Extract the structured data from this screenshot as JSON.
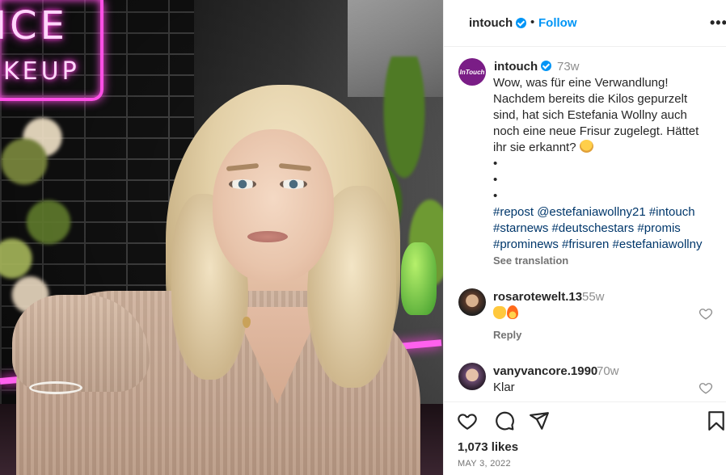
{
  "header": {
    "username": "intouch",
    "separator": "•",
    "follow_label": "Follow",
    "more_label": "•••"
  },
  "photo": {
    "neon_line1": "ICE",
    "neon_line2": "KEUP"
  },
  "post": {
    "avatar_text": "InTouch",
    "username": "intouch",
    "time": "73w",
    "caption_lines": [
      "Wow, was für eine Verwandlung!",
      "Nachdem bereits die Kilos gepurzelt",
      "sind, hat sich Estefania Wollny auch",
      "noch eine neue Frisur zugelegt. Hättet",
      "ihr sie erkannt?"
    ],
    "bullets": [
      "•",
      "•",
      "•"
    ],
    "hashtag_lines": [
      "#repost @estefaniawollny21 #intouch",
      "#starnews #deutschestars #promis",
      "#prominews #frisuren #estefaniawollny"
    ],
    "see_translation": "See translation"
  },
  "comments": [
    {
      "username": "rosarotewelt.13",
      "time": "55w",
      "text": "",
      "reply": "Reply"
    },
    {
      "username": "vanyvancore.1990",
      "time": "70w",
      "text": "Klar"
    }
  ],
  "footer": {
    "likes": "1,073 likes",
    "date": "MAY 3, 2022"
  },
  "colors": {
    "accent": "#0095f6",
    "hashtag": "#00376b",
    "muted": "#737373",
    "brand_avatar": "#7a1d86"
  },
  "icons": {
    "verified": "verified-badge-icon",
    "like": "heart-icon",
    "comment": "comment-icon",
    "share": "paper-plane-icon",
    "save": "bookmark-icon"
  }
}
